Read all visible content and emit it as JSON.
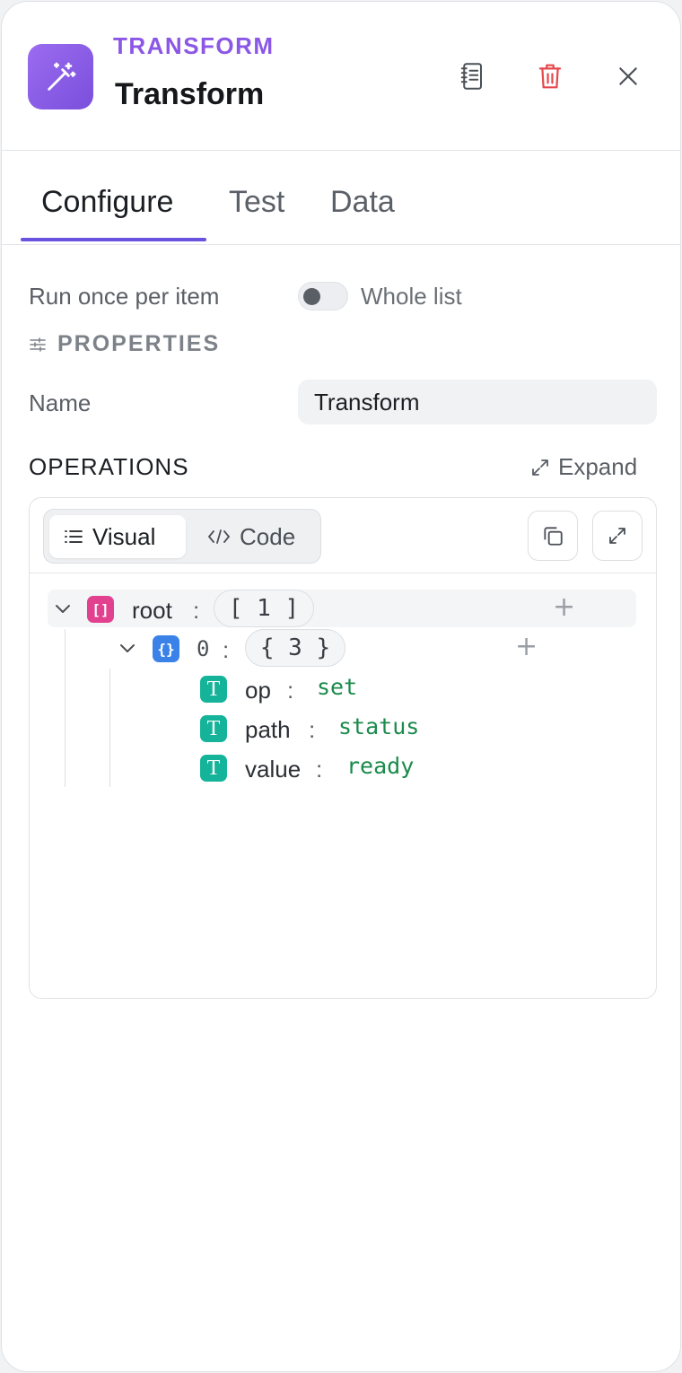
{
  "header": {
    "node_type": "TRANSFORM",
    "node_title": "Transform",
    "icon": "magic-wand-icon",
    "actions": [
      "docs-icon",
      "trash-icon",
      "close-icon"
    ],
    "accent_color": "#8b57e6",
    "danger_color": "#e5484d"
  },
  "tabs": [
    {
      "label": "Configure",
      "active": true
    },
    {
      "label": "Test",
      "active": false
    },
    {
      "label": "Data",
      "active": false
    }
  ],
  "settings": {
    "run_label": "Run once per item",
    "toggle_label": "Whole list",
    "toggle_on": false,
    "properties_heading": "PROPERTIES",
    "name_label": "Name",
    "name_value": "Transform"
  },
  "operations": {
    "heading": "OPERATIONS",
    "expand_label": "Expand",
    "view_modes": [
      {
        "label": "Visual",
        "active": true
      },
      {
        "label": "Code",
        "active": false
      }
    ],
    "tree": {
      "root_key": "root",
      "root_count": "[ 1 ]",
      "item_key": "0",
      "item_count": "{ 3 }",
      "fields": [
        {
          "key": "op",
          "value": "set"
        },
        {
          "key": "path",
          "value": "status"
        },
        {
          "key": "value",
          "value": "ready"
        }
      ]
    }
  }
}
